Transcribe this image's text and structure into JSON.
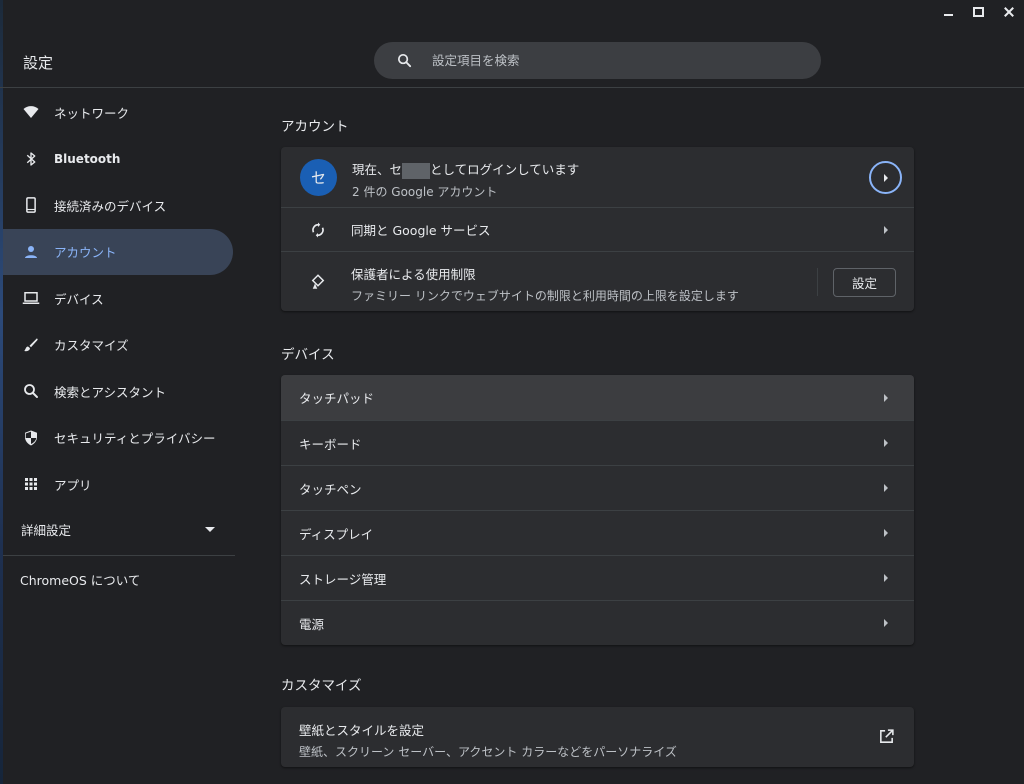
{
  "window": {
    "title": "設定",
    "controls": {
      "minimize": "minimize",
      "maximize": "maximize",
      "close": "close"
    }
  },
  "search": {
    "placeholder": "設定項目を検索"
  },
  "sidebar": {
    "items": [
      {
        "label": "ネットワーク",
        "icon": "wifi-icon"
      },
      {
        "label": "Bluetooth",
        "icon": "bluetooth-icon"
      },
      {
        "label": "接続済みのデバイス",
        "icon": "phone-icon"
      },
      {
        "label": "アカウント",
        "icon": "person-icon",
        "active": true
      },
      {
        "label": "デバイス",
        "icon": "laptop-icon"
      },
      {
        "label": "カスタマイズ",
        "icon": "brush-icon"
      },
      {
        "label": "検索とアシスタント",
        "icon": "search-icon"
      },
      {
        "label": "セキュリティとプライバシー",
        "icon": "shield-icon"
      },
      {
        "label": "アプリ",
        "icon": "apps-grid-icon"
      }
    ],
    "advanced": "詳細設定",
    "about": "ChromeOS について"
  },
  "sections": {
    "account": {
      "title": "アカウント",
      "signin": {
        "avatar_letter": "セ",
        "line_prefix": "現在、セ",
        "line_suffix": "としてログインしています",
        "sub": "2 件の Google アカウント"
      },
      "sync": {
        "label": "同期と Google サービス"
      },
      "parental": {
        "label": "保護者による使用制限",
        "sub": "ファミリー リンクでウェブサイトの制限と利用時間の上限を設定します",
        "button": "設定"
      }
    },
    "device": {
      "title": "デバイス",
      "items": [
        "タッチパッド",
        "キーボード",
        "タッチペン",
        "ディスプレイ",
        "ストレージ管理",
        "電源"
      ]
    },
    "customize": {
      "title": "カスタマイズ",
      "wallpaper": {
        "label": "壁紙とスタイルを設定",
        "sub": "壁紙、スクリーン セーバー、アクセント カラーなどをパーソナライズ"
      }
    }
  },
  "colors": {
    "background": "#202124",
    "card": "#2c2d30",
    "accent": "#8ab4f8",
    "active_nav": "#394457",
    "avatar": "#1a5fb4"
  }
}
